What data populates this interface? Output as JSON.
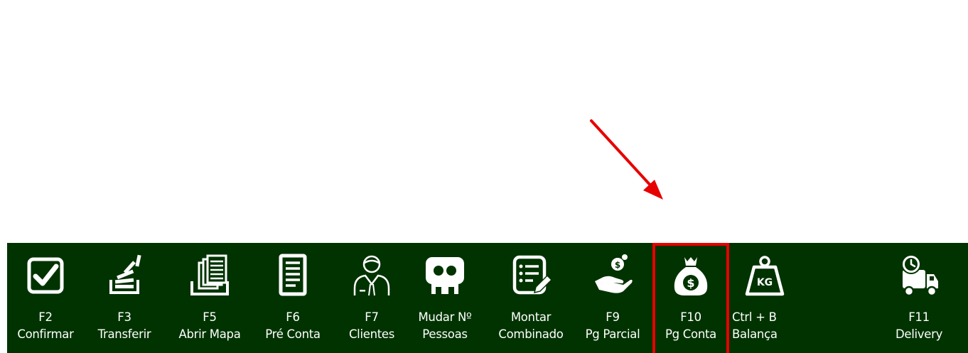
{
  "colors": {
    "toolbar_bg": "#003300",
    "toolbar_text": "#ffffff",
    "highlight": "#e60000",
    "arrow": "#e60000"
  },
  "toolbar": {
    "buttons": [
      {
        "key": "F2",
        "label": "Confirmar",
        "icon": "checkbox-icon"
      },
      {
        "key": "F3",
        "label": "Transferir",
        "icon": "stack-transfer-icon"
      },
      {
        "key": "F5",
        "label": "Abrir Mapa",
        "icon": "documents-tray-icon"
      },
      {
        "key": "F6",
        "label": "Pré Conta",
        "icon": "document-icon"
      },
      {
        "key": "F7",
        "label": "Clientes",
        "icon": "person-icon"
      },
      {
        "key": "Mudar Nº",
        "label": "Pessoas",
        "icon": "people-icon"
      },
      {
        "key": "Montar",
        "label": "Combinado",
        "icon": "list-edit-icon"
      },
      {
        "key": "F9",
        "label": "Pg Parcial",
        "icon": "hand-coin-icon"
      },
      {
        "key": "F10",
        "label": "Pg Conta",
        "icon": "money-bag-icon"
      },
      {
        "key": "Ctrl + B",
        "label": "Balança",
        "icon": "scale-weight-icon"
      },
      {
        "key": "F11",
        "label": "Delivery",
        "icon": "delivery-truck-icon"
      }
    ]
  }
}
